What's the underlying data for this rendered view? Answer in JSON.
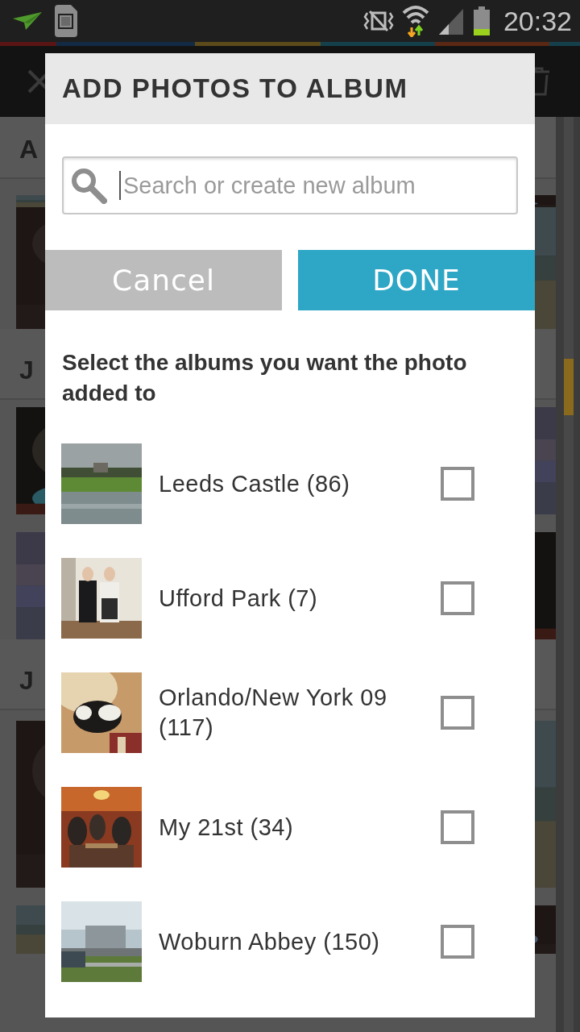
{
  "status_bar": {
    "time": "20:32"
  },
  "background": {
    "sections": [
      {
        "letter": "A"
      },
      {
        "letter": "J"
      },
      {
        "letter": "J"
      }
    ]
  },
  "dialog": {
    "title": "ADD PHOTOS TO ALBUM",
    "search": {
      "placeholder": "Search or create new album"
    },
    "buttons": [
      {
        "label": "Cancel",
        "kind": "cancel"
      },
      {
        "label": "DONE",
        "kind": "confirm"
      }
    ],
    "instruction": "Select the albums you want the photo added to",
    "albums": [
      {
        "name": "Leeds Castle (86)",
        "checked": false
      },
      {
        "name": "Ufford Park (7)",
        "checked": false
      },
      {
        "name": "Orlando/New York 09 (117)",
        "checked": false
      },
      {
        "name": "My 21st (34)",
        "checked": false
      },
      {
        "name": "Woburn Abbey (150)",
        "checked": false
      }
    ]
  }
}
